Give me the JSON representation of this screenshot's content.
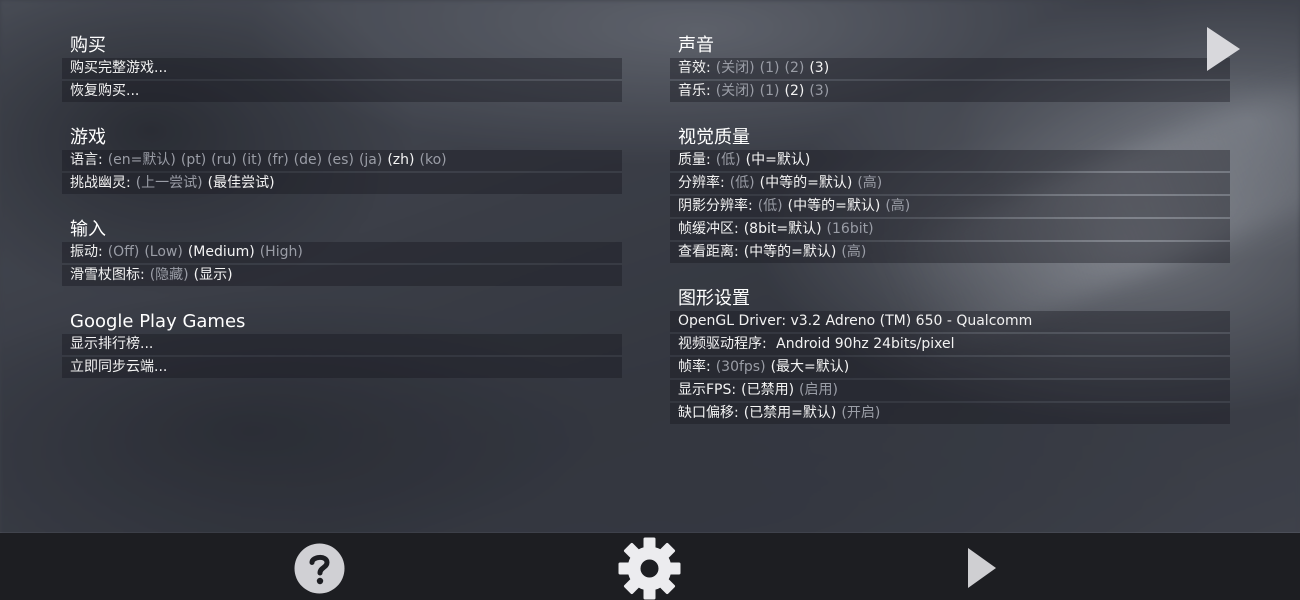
{
  "purchase": {
    "title": "购买",
    "buy_full": "购买完整游戏...",
    "restore": "恢复购买..."
  },
  "game": {
    "title": "游戏",
    "language": {
      "label": "语言:",
      "options": [
        "(en=默认)",
        "(pt)",
        "(ru)",
        "(it)",
        "(fr)",
        "(de)",
        "(es)",
        "(ja)",
        "(zh)",
        "(ko)"
      ],
      "selected": "(zh)"
    },
    "ghost": {
      "label": "挑战幽灵:",
      "options": [
        "(上一尝试)",
        "(最佳尝试)"
      ],
      "selected": "(最佳尝试)"
    }
  },
  "input": {
    "title": "输入",
    "vibration": {
      "label": "振动:",
      "options": [
        "(Off)",
        "(Low)",
        "(Medium)",
        "(High)"
      ],
      "selected": "(Medium)"
    },
    "pole_icon": {
      "label": "滑雪杖图标:",
      "options": [
        "(隐藏)",
        "(显示)"
      ],
      "selected": "(显示)"
    }
  },
  "gpg": {
    "title": "Google Play Games",
    "leaderboard": "显示排行榜...",
    "cloud_sync": "立即同步云端..."
  },
  "sound": {
    "title": "声音",
    "sfx": {
      "label": "音效:",
      "options": [
        "(关闭)",
        "(1)",
        "(2)",
        "(3)"
      ],
      "selected": "(3)"
    },
    "music": {
      "label": "音乐:",
      "options": [
        "(关闭)",
        "(1)",
        "(2)",
        "(3)"
      ],
      "selected": "(2)"
    }
  },
  "visual": {
    "title": "视觉质量",
    "quality": {
      "label": "质量:",
      "options": [
        "(低)",
        "(中=默认)"
      ],
      "selected": "(中=默认)"
    },
    "resolution": {
      "label": "分辨率:",
      "options": [
        "(低)",
        "(中等的=默认)",
        "(高)"
      ],
      "selected": "(中等的=默认)"
    },
    "shadow_res": {
      "label": "阴影分辨率:",
      "options": [
        "(低)",
        "(中等的=默认)",
        "(高)"
      ],
      "selected": "(中等的=默认)"
    },
    "framebuffer": {
      "label": "帧缓冲区:",
      "options": [
        "(8bit=默认)",
        "(16bit)"
      ],
      "selected": "(8bit=默认)"
    },
    "view_distance": {
      "label": "查看距离:",
      "options": [
        "(中等的=默认)",
        "(高)"
      ],
      "selected": "(中等的=默认)"
    }
  },
  "graphics": {
    "title": "图形设置",
    "opengl": "OpenGL Driver: v3.2 Adreno (TM) 650 - Qualcomm",
    "video_driver_label": "视频驱动程序:",
    "video_driver_value": "Android 90hz 24bits/pixel",
    "framerate": {
      "label": "帧率:",
      "options": [
        "(30fps)",
        "(最大=默认)"
      ],
      "selected": "(最大=默认)"
    },
    "show_fps": {
      "label": "显示FPS:",
      "options": [
        "(已禁用)",
        "(启用)"
      ],
      "selected": "(已禁用)"
    },
    "notch_offset": {
      "label": "缺口偏移:",
      "options": [
        "(已禁用=默认)",
        "(开启)"
      ],
      "selected": "(已禁用=默认)"
    }
  },
  "icons": {
    "top_play": "play-icon",
    "help": "question-mark-icon",
    "settings": "gear-icon",
    "play": "play-icon"
  },
  "colors": {
    "selected_text": "#f4f4f4",
    "unselected_text": "#9a9da6",
    "bar": "#1d1e22",
    "icon": "#d0d0d4"
  }
}
